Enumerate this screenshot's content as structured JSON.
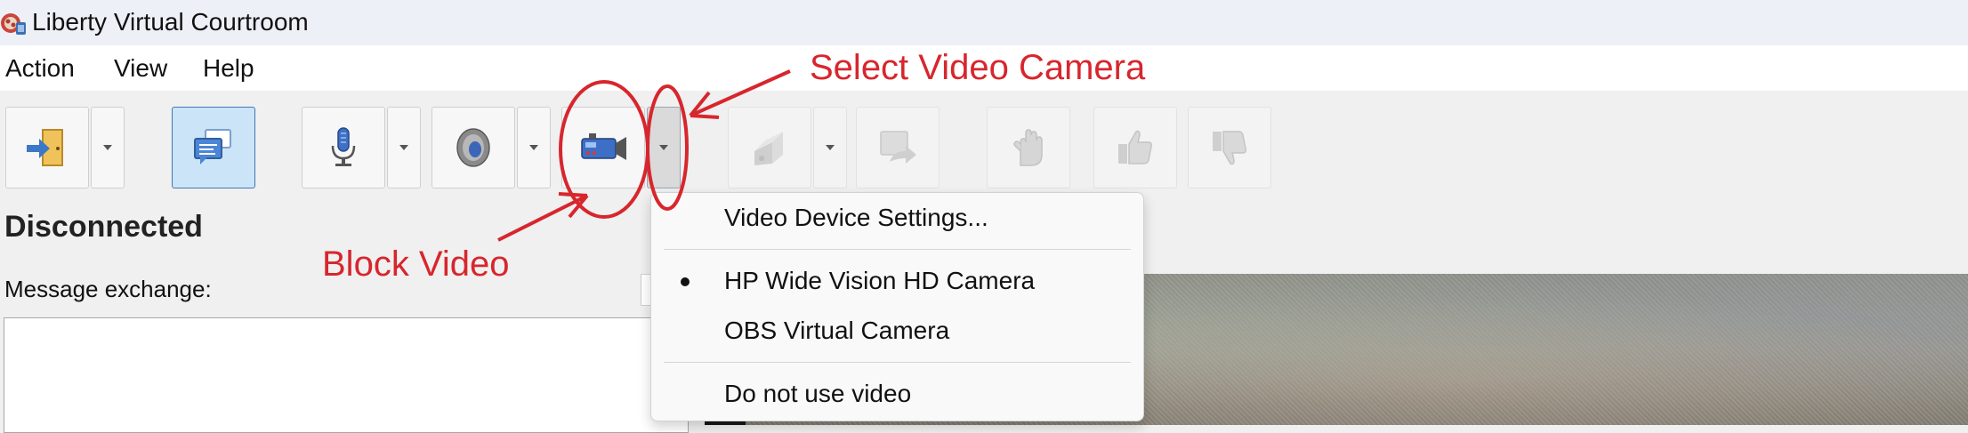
{
  "window": {
    "title": "Liberty Virtual Courtroom",
    "icon": "courtroom-app-icon"
  },
  "menu": {
    "items": [
      "Action",
      "View",
      "Help"
    ]
  },
  "toolbar": {
    "buttons": [
      {
        "name": "exit-door-icon",
        "dropdown": true,
        "enabled": true
      },
      {
        "name": "chat-icon",
        "dropdown": false,
        "enabled": true,
        "active": true
      },
      {
        "name": "microphone-icon",
        "dropdown": true,
        "enabled": true
      },
      {
        "name": "speaker-icon",
        "dropdown": true,
        "enabled": true
      },
      {
        "name": "video-camera-icon",
        "dropdown": true,
        "enabled": true
      },
      {
        "name": "share-screen-icon",
        "dropdown": true,
        "enabled": false
      },
      {
        "name": "forward-icon",
        "dropdown": false,
        "enabled": false
      },
      {
        "name": "raise-hand-icon",
        "dropdown": false,
        "enabled": false
      },
      {
        "name": "thumbs-up-icon",
        "dropdown": false,
        "enabled": false
      },
      {
        "name": "thumbs-down-icon",
        "dropdown": false,
        "enabled": false
      }
    ]
  },
  "status": {
    "title": "Disconnected"
  },
  "messages": {
    "label": "Message exchange:"
  },
  "video_menu": {
    "settings_label": "Video Device Settings...",
    "devices": [
      {
        "label": "HP Wide Vision HD Camera",
        "selected": true
      },
      {
        "label": "OBS Virtual Camera",
        "selected": false
      }
    ],
    "no_video_label": "Do not use video"
  },
  "annotations": {
    "select_camera": "Select Video Camera",
    "block_video": "Block Video",
    "color": "#d7262d"
  }
}
